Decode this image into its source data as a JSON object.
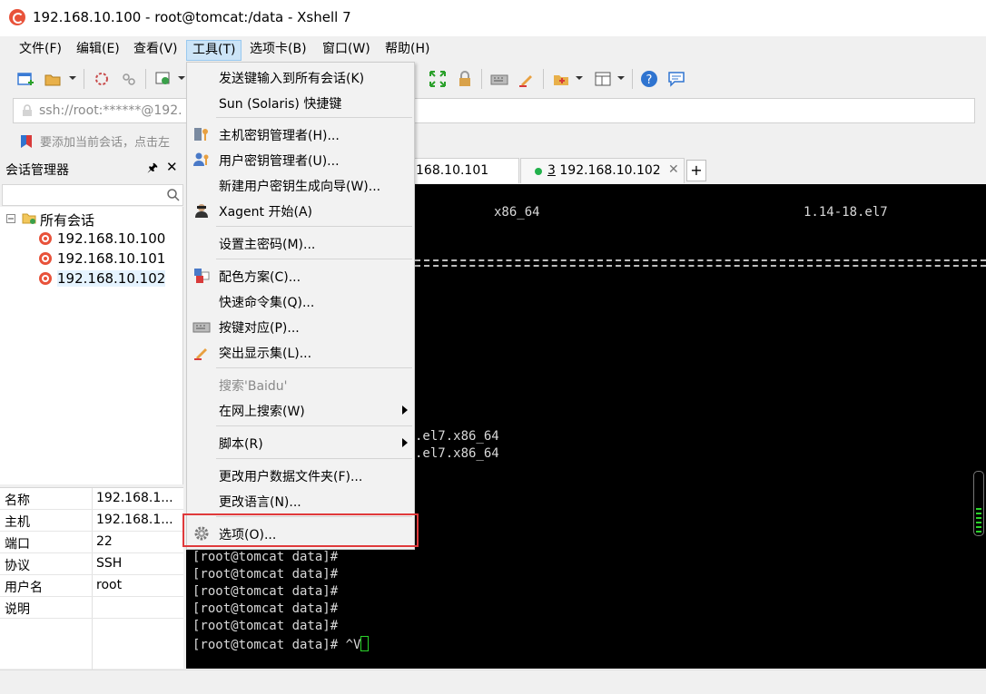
{
  "window": {
    "title": "192.168.10.100 - root@tomcat:/data - Xshell 7"
  },
  "menubar": {
    "items": [
      "文件(F)",
      "编辑(E)",
      "查看(V)",
      "工具(T)",
      "选项卡(B)",
      "窗口(W)",
      "帮助(H)"
    ],
    "open_index": 3
  },
  "addressbar": {
    "value": "ssh://root:******@192."
  },
  "infobar": {
    "message": "要添加当前会话，点击左"
  },
  "session_manager": {
    "title": "会话管理器",
    "pin_icon": "pin-icon",
    "close_icon": "close-icon",
    "search_placeholder": "",
    "tree": {
      "root": "所有会话",
      "items": [
        "192.168.10.100",
        "192.168.10.101",
        "192.168.10.102"
      ],
      "selected_index": 2
    },
    "properties": [
      {
        "key": "名称",
        "value": "192.168.1..."
      },
      {
        "key": "主机",
        "value": "192.168.1..."
      },
      {
        "key": "端口",
        "value": "22"
      },
      {
        "key": "协议",
        "value": "SSH"
      },
      {
        "key": "用户名",
        "value": "root"
      },
      {
        "key": "说明",
        "value": ""
      }
    ]
  },
  "tabs": [
    {
      "label": "168.10.101",
      "active": false
    },
    {
      "label": "3 192.168.10.102",
      "number": "3",
      "host": "192.168.10.102",
      "active": false,
      "status_color": "#22b14c"
    }
  ],
  "add_tab_label": "+",
  "terminal": {
    "top_line": {
      "arch": "x86_64",
      "version": "1.14-18.el7"
    },
    "pkg_lines": [
      ".el7.x86_64",
      ".el7.x86_64"
    ],
    "prompt_lines": [
      "[root@tomcat data]#",
      "[root@tomcat data]#",
      "[root@tomcat data]#",
      "[root@tomcat data]#",
      "[root@tomcat data]#"
    ],
    "last_line": "[root@tomcat data]# ^V",
    "cursor_color": "#2bd42b"
  },
  "tools_menu": {
    "items": [
      {
        "label": "发送键输入到所有会话(K)",
        "icon": ""
      },
      {
        "label": "Sun (Solaris) 快捷键",
        "icon": ""
      },
      {
        "label": "主机密钥管理者(H)...",
        "icon": "host-key-icon"
      },
      {
        "label": "用户密钥管理者(U)...",
        "icon": "user-key-icon"
      },
      {
        "label": "新建用户密钥生成向导(W)...",
        "icon": ""
      },
      {
        "label": "Xagent 开始(A)",
        "icon": "xagent-icon"
      },
      {
        "label": "设置主密码(M)...",
        "icon": ""
      },
      {
        "label": "配色方案(C)...",
        "icon": "color-scheme-icon"
      },
      {
        "label": "快速命令集(Q)...",
        "icon": ""
      },
      {
        "label": "按键对应(P)...",
        "icon": "keyboard-icon"
      },
      {
        "label": "突出显示集(L)...",
        "icon": "highlighter-icon"
      },
      {
        "label": "搜索'Baidu'",
        "icon": "",
        "disabled": true
      },
      {
        "label": "在网上搜索(W)",
        "icon": "",
        "submenu": true
      },
      {
        "label": "脚本(R)",
        "icon": "",
        "submenu": true
      },
      {
        "label": "更改用户数据文件夹(F)...",
        "icon": ""
      },
      {
        "label": "更改语言(N)...",
        "icon": ""
      },
      {
        "label": "选项(O)...",
        "icon": "gear-icon",
        "highlighted": true
      }
    ],
    "highlight_color": "#e0393b"
  }
}
